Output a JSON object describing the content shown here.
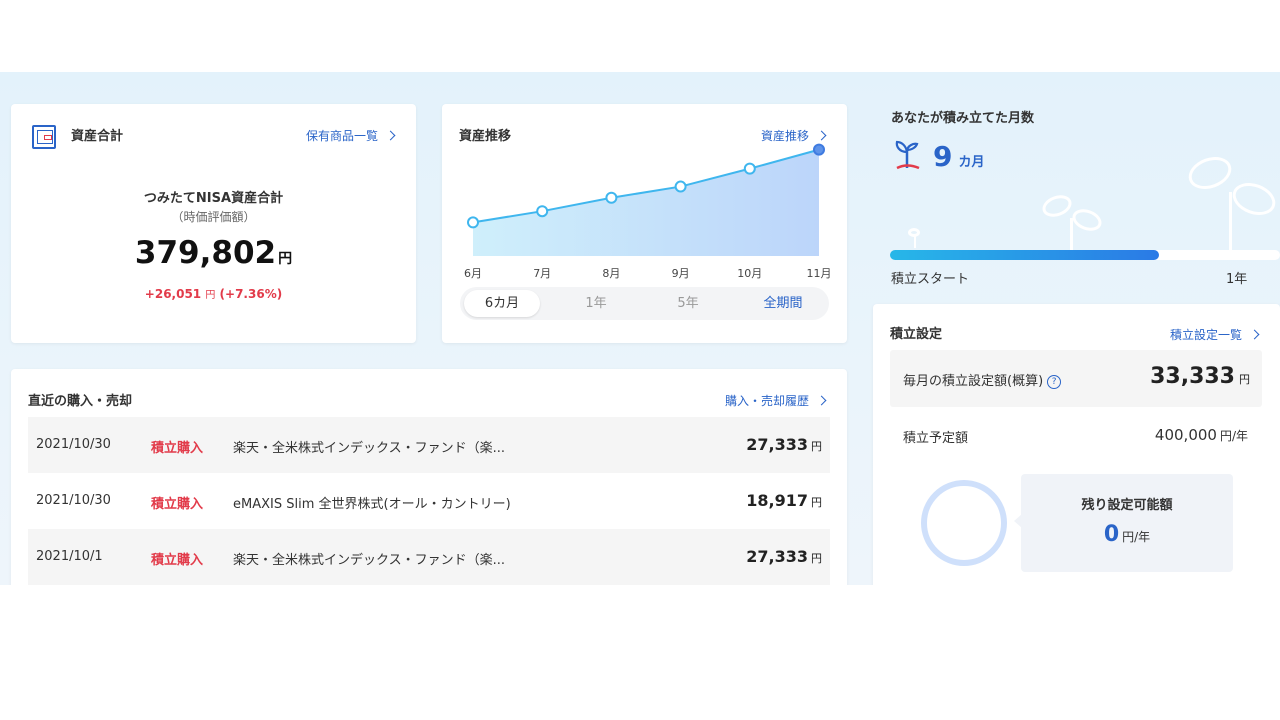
{
  "asset": {
    "title": "資産合計",
    "link": "保有商品一覧",
    "subtitle": "つみたてNISA資産合計",
    "note": "（時価評価額）",
    "total": "379,802",
    "total_unit": "円",
    "gain": "+26,051",
    "gain_unit": "円",
    "gain_pct": "(+7.36%)"
  },
  "trend": {
    "title": "資産推移",
    "link": "資産推移",
    "range_tabs": [
      {
        "label": "6カ月",
        "active": true
      },
      {
        "label": "1年",
        "active": false
      },
      {
        "label": "5年",
        "active": false
      },
      {
        "label": "全期間",
        "active": false
      }
    ]
  },
  "chart_data": {
    "type": "area",
    "categories": [
      "6月",
      "7月",
      "8月",
      "9月",
      "10月",
      "11月"
    ],
    "values": [
      0.3,
      0.4,
      0.52,
      0.62,
      0.78,
      0.95
    ],
    "title": "",
    "xlabel": "",
    "ylabel": "",
    "ylim": [
      0,
      1
    ],
    "grid": false,
    "colors": {
      "line": "#3fb6ee",
      "fill_top": "#bcd5fa",
      "fill_bottom": "#cfeffb",
      "last_point": "#5e93e9"
    }
  },
  "transactions": {
    "title": "直近の購入・売却",
    "link": "購入・売却履歴",
    "rows": [
      {
        "date": "2021/10/30",
        "kind": "積立購入",
        "fund": "楽天・全米株式インデックス・ファンド（楽...",
        "amount": "27,333",
        "unit": "円"
      },
      {
        "date": "2021/10/30",
        "kind": "積立購入",
        "fund": "eMAXIS Slim 全世界株式(オール・カントリー)",
        "amount": "18,917",
        "unit": "円"
      },
      {
        "date": "2021/10/1",
        "kind": "積立購入",
        "fund": "楽天・全米株式インデックス・ファンド（楽...",
        "amount": "27,333",
        "unit": "円"
      }
    ]
  },
  "months": {
    "title": "あなたが積み立てた月数",
    "count": "9",
    "unit": "カ月",
    "start_label": "積立スタート",
    "end_label": "1年",
    "progress": 0.69
  },
  "setting": {
    "title": "積立設定",
    "link": "積立設定一覧",
    "monthly_label": "毎月の積立設定額(概算)",
    "help": "?",
    "monthly_value": "33,333",
    "monthly_unit": "円",
    "planned_label": "積立予定額",
    "planned_value": "400,000",
    "planned_unit": "円/年",
    "remain_label": "残り設定可能額",
    "remain_value": "0",
    "remain_unit": "円/年"
  },
  "colors": {
    "accent": "#2a64c8",
    "red": "#e23b4a",
    "band": "#e6f3fb"
  }
}
